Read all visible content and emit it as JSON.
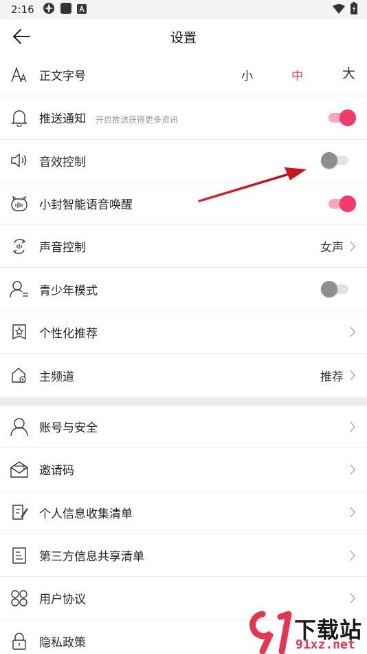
{
  "status_bar": {
    "time": "2:16"
  },
  "header": {
    "title": "设置"
  },
  "font_size": {
    "label": "正文字号",
    "options": [
      "小",
      "中",
      "大"
    ],
    "selected": "中",
    "selected_color": "#e84a4a"
  },
  "settings_group_1": [
    {
      "label": "推送通知",
      "hint": "开启推送获得更多资讯",
      "toggle": "on",
      "icon": "bell-icon"
    },
    {
      "label": "音效控制",
      "toggle": "off",
      "icon": "speaker-icon"
    },
    {
      "label": "小封智能语音唤醒",
      "toggle": "on",
      "icon": "voice-assistant-icon"
    },
    {
      "label": "声音控制",
      "value": "女声",
      "icon": "voice-control-icon"
    },
    {
      "label": "青少年模式",
      "toggle": "off",
      "icon": "teen-mode-icon"
    },
    {
      "label": "个性化推荐",
      "icon": "star-bookmark-icon"
    },
    {
      "label": "主频道",
      "value": "推荐",
      "icon": "home-channel-icon"
    }
  ],
  "settings_group_2": [
    {
      "label": "账号与安全",
      "icon": "user-icon"
    },
    {
      "label": "邀请码",
      "icon": "mail-icon"
    },
    {
      "label": "个人信息收集清单",
      "icon": "edit-list-icon"
    },
    {
      "label": "第三方信息共享清单",
      "icon": "document-icon"
    },
    {
      "label": "用户协议",
      "icon": "grid-icon"
    },
    {
      "label": "隐私政策",
      "icon": "lock-icon"
    }
  ],
  "watermark": {
    "logo_text": "下载站",
    "site": "91xz.net"
  },
  "colors": {
    "accent": "#f23a6a",
    "toggle_on_track": "#f7a7bd",
    "arrow": "#d4181e"
  }
}
